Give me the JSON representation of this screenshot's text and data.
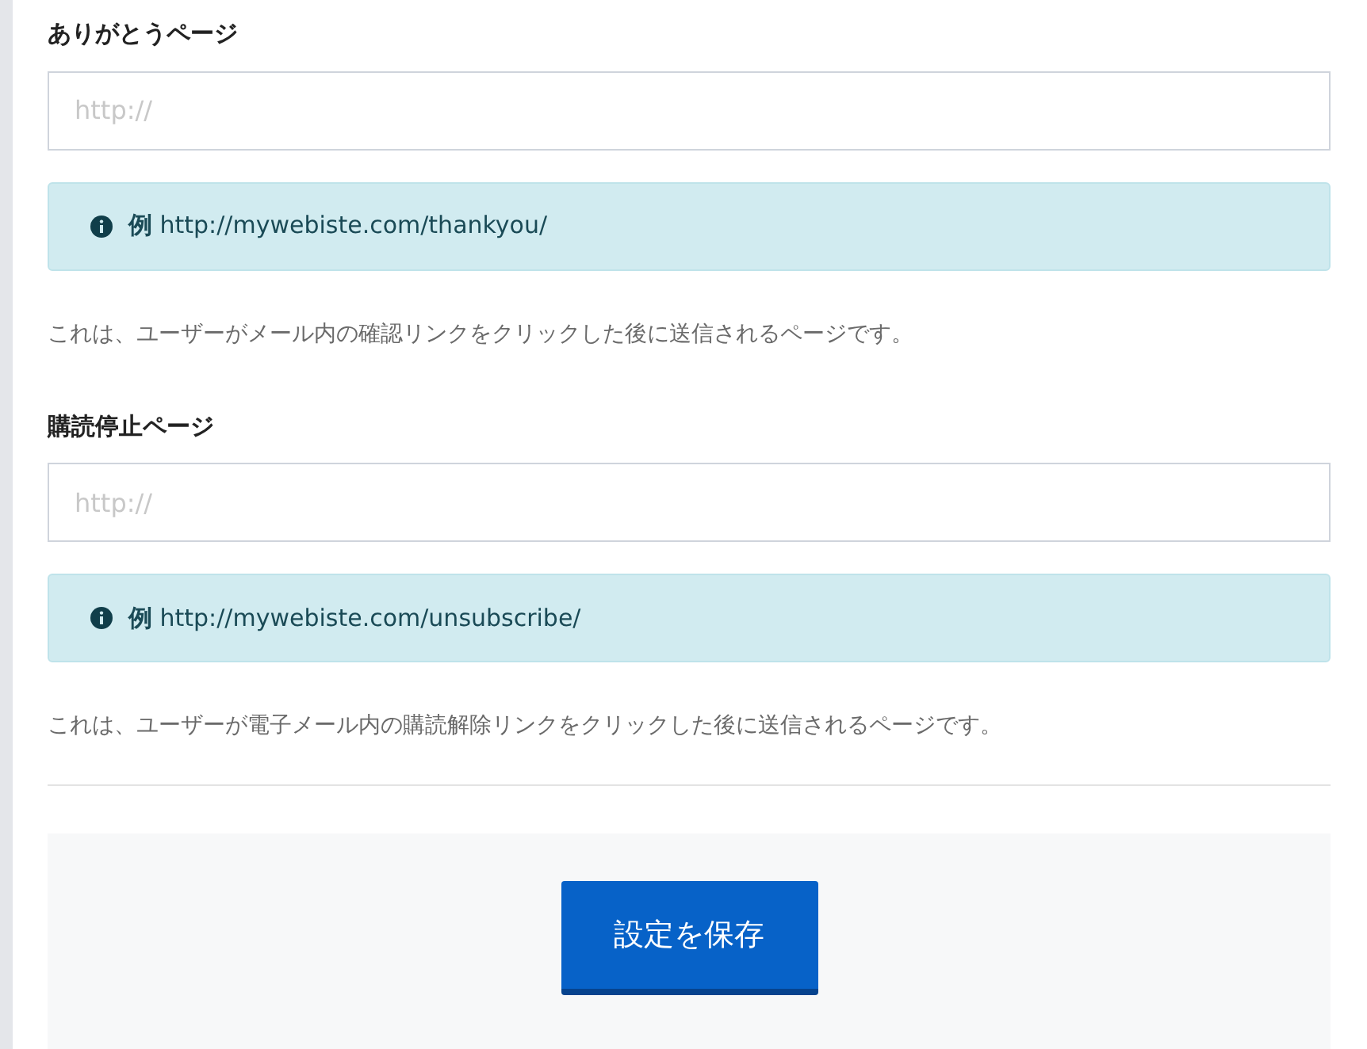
{
  "sections": [
    {
      "label": "ありがとうページ",
      "placeholder": "http://",
      "example": "**例** http://mywebiste.com/thankyou/",
      "help": "これは、ユーザーがメール内の確認リンクをクリックした後に送信されるページです。"
    },
    {
      "label": "購読停止ページ",
      "placeholder": "http://",
      "example": "**例** http://mywebiste.com/unsubscribe/",
      "help": "これは、ユーザーが電子メール内の購読解除リンクをクリックした後に送信されるページです。"
    }
  ],
  "save_button": "設定を保存"
}
